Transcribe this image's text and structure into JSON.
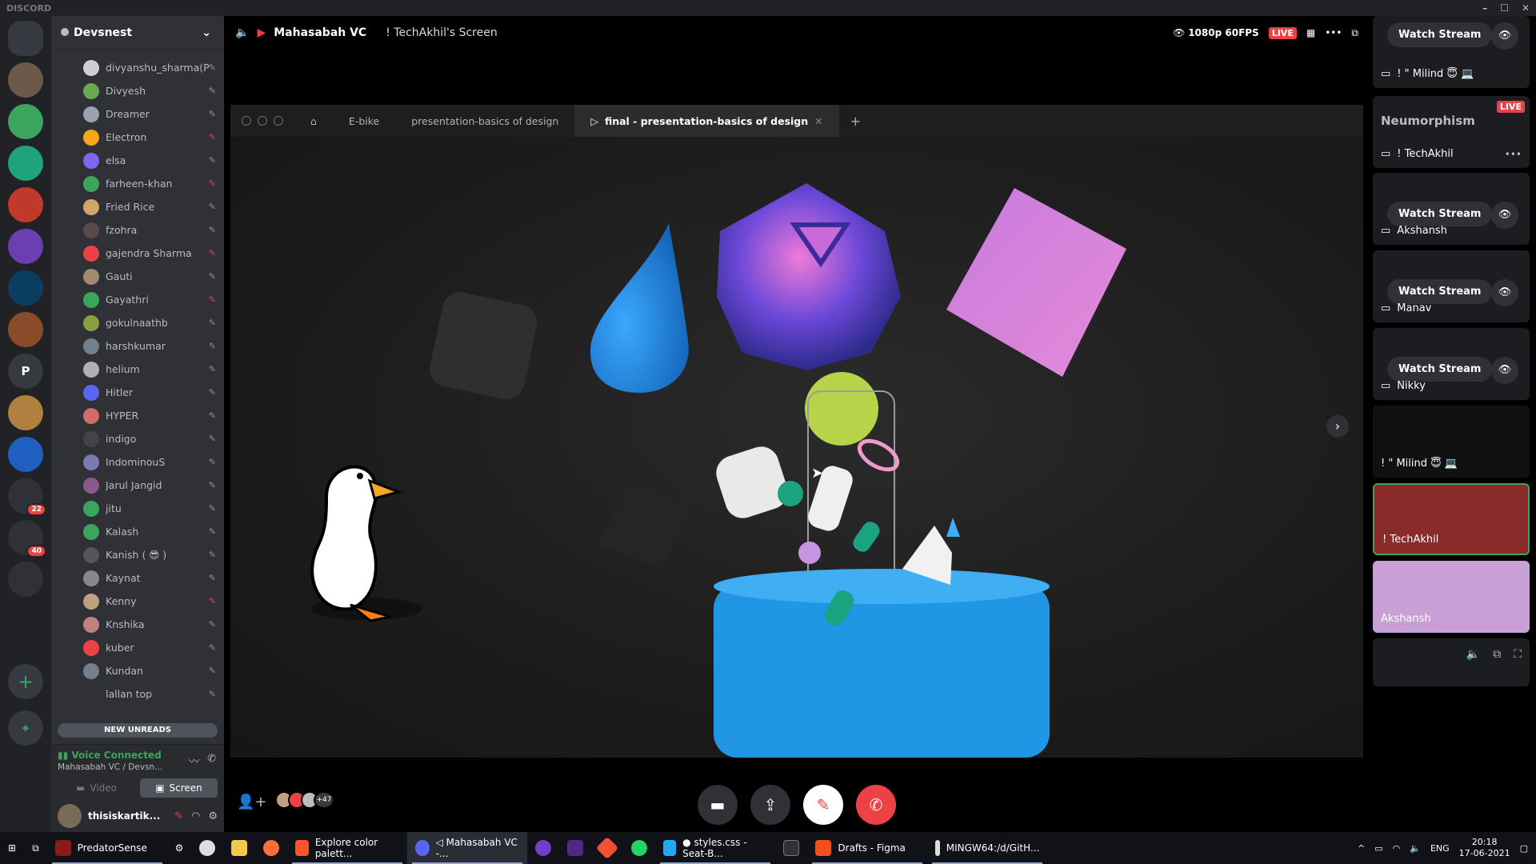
{
  "app": {
    "title": "DISCORD"
  },
  "server": {
    "name": "Devsnest"
  },
  "guilds": [
    {
      "name": "home",
      "color": "#36393f",
      "letter": ""
    },
    {
      "name": "user1",
      "color": "#6b5a4a",
      "letter": ""
    },
    {
      "name": "g2",
      "color": "#3ba55d",
      "letter": ""
    },
    {
      "name": "g3",
      "color": "#1fa37a",
      "letter": ""
    },
    {
      "name": "gamer",
      "color": "#c0392b",
      "letter": ""
    },
    {
      "name": "g5",
      "color": "#6a3fb0",
      "letter": ""
    },
    {
      "name": "g6",
      "color": "#0b3d63",
      "letter": ""
    },
    {
      "name": "g7",
      "color": "#8a4b2a",
      "letter": ""
    },
    {
      "name": "p",
      "color": "#36393f",
      "letter": "P"
    },
    {
      "name": "g9",
      "color": "#b08040",
      "letter": ""
    },
    {
      "name": "g10",
      "color": "#1e5fbf",
      "letter": ""
    },
    {
      "name": "folder1",
      "color": "#2f3136",
      "letter": "",
      "badge": "22"
    },
    {
      "name": "folder2",
      "color": "#2f3136",
      "letter": "",
      "badge": "40"
    },
    {
      "name": "folder3",
      "color": "#2f3136",
      "letter": ""
    }
  ],
  "members": [
    {
      "name": "divyanshu_sharma(P)",
      "muted": false,
      "color": "#cfcfcf"
    },
    {
      "name": "Divyesh",
      "muted": false,
      "color": "#6aa84f"
    },
    {
      "name": "Dreamer",
      "muted": false,
      "color": "#9aa3ad"
    },
    {
      "name": "Electron",
      "muted": true,
      "color": "#faa61a"
    },
    {
      "name": "elsa",
      "muted": false,
      "color": "#7b68ee"
    },
    {
      "name": "farheen-khan",
      "muted": true,
      "color": "#3ba55d"
    },
    {
      "name": "Fried Rice",
      "muted": false,
      "color": "#d2a56b"
    },
    {
      "name": "fzohra",
      "muted": false,
      "color": "#5a4a4a"
    },
    {
      "name": "gajendra Sharma",
      "muted": true,
      "color": "#ed4245"
    },
    {
      "name": "Gauti",
      "muted": false,
      "color": "#a08a70"
    },
    {
      "name": "Gayathri",
      "muted": true,
      "color": "#3ba55d"
    },
    {
      "name": "gokulnaathb",
      "muted": false,
      "color": "#8aa040"
    },
    {
      "name": "harshkumar",
      "muted": false,
      "color": "#747f8d"
    },
    {
      "name": "helium",
      "muted": false,
      "color": "#b0b0b0"
    },
    {
      "name": "Hitler",
      "muted": false,
      "color": "#5865f2"
    },
    {
      "name": "HYPER",
      "muted": false,
      "color": "#d46a6a"
    },
    {
      "name": "indigo",
      "muted": false,
      "color": "#444"
    },
    {
      "name": "IndominouS",
      "muted": false,
      "color": "#7a7ab0"
    },
    {
      "name": "Jarul Jangid",
      "muted": false,
      "color": "#8a5a8a"
    },
    {
      "name": "jitu",
      "muted": false,
      "color": "#3ba55d"
    },
    {
      "name": "Kalash",
      "muted": false,
      "color": "#3ba55d"
    },
    {
      "name": "Kanish ( 😎 )",
      "muted": false,
      "color": "#555"
    },
    {
      "name": "Kaynat",
      "muted": false,
      "color": "#888"
    },
    {
      "name": "Kenny",
      "muted": true,
      "color": "#c0a080"
    },
    {
      "name": "Knshika",
      "muted": false,
      "color": "#c08080"
    },
    {
      "name": "kuber",
      "muted": false,
      "color": "#ed4245"
    },
    {
      "name": "Kundan",
      "muted": false,
      "color": "#747f8d"
    },
    {
      "name": "lallan top",
      "muted": false,
      "color": "#2f3136"
    }
  ],
  "new_unreads": "NEW UNREADS",
  "voice": {
    "status": "Voice Connected",
    "channel": "Mahasabah VC / Devsn...",
    "video_label": "Video",
    "screen_label": "Screen"
  },
  "user": {
    "name": "thisiskartik..."
  },
  "topbar": {
    "channel": "Mahasabah VC",
    "screen": "! TechAkhil's Screen",
    "quality": "1080p 60FPS",
    "live": "LIVE"
  },
  "figma_tabs": [
    "E-bike",
    "presentation-basics of design",
    "final - presentation-basics of design"
  ],
  "callbar": {
    "more_count": "+47"
  },
  "rail": [
    {
      "type": "stream",
      "user": "! \" Milind 😇 💻",
      "button": "Watch Stream"
    },
    {
      "type": "live",
      "user": "! TechAkhil",
      "title": "Neumorphism",
      "live": "LIVE"
    },
    {
      "type": "stream",
      "user": "Akshansh",
      "button": "Watch Stream"
    },
    {
      "type": "stream",
      "user": "Manav",
      "button": "Watch Stream"
    },
    {
      "type": "stream",
      "user": "Nikky",
      "button": "Watch Stream"
    },
    {
      "type": "cam",
      "user": "! \" Milind 😇 💻"
    },
    {
      "type": "cam",
      "user": "! TechAkhil"
    },
    {
      "type": "cam",
      "user": "Akshansh"
    }
  ],
  "taskbar": {
    "items": [
      "PredatorSense",
      "Explore color palett...",
      "◁ Mahasabah VC -...",
      "● styles.css - Seat-B...",
      "Drafts - Figma",
      "MINGW64:/d/GitH..."
    ],
    "lang": "ENG",
    "time": "20:18",
    "date": "17-06-2021"
  },
  "colors": {
    "accent": "#5865f2",
    "danger": "#ed4245",
    "online": "#3ba55d"
  }
}
